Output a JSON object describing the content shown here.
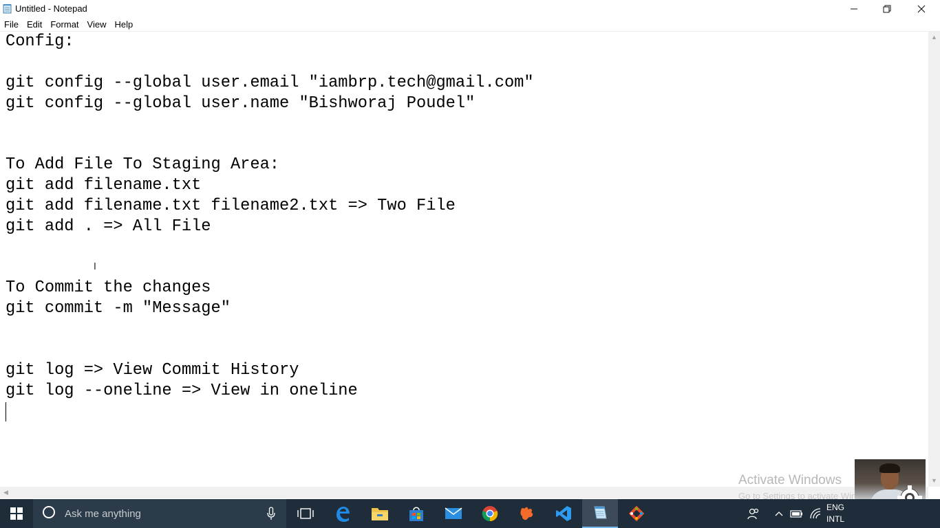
{
  "window": {
    "title": "Untitled - Notepad",
    "icon": "notepad-icon"
  },
  "menu": [
    "File",
    "Edit",
    "Format",
    "View",
    "Help"
  ],
  "editor": {
    "lines": [
      "Config:",
      "",
      "git config --global user.email \"iambrp.tech@gmail.com\"",
      "git config --global user.name \"Bishworaj Poudel\"",
      "",
      "",
      "To Add File To Staging Area:",
      "git add filename.txt",
      "git add filename.txt filename2.txt => Two File",
      "git add . => All File",
      "",
      "",
      "To Commit the changes",
      "git commit -m \"Message\"",
      "",
      "",
      "git log => View Commit History",
      "git log --oneline => View in oneline",
      ""
    ]
  },
  "watermark": {
    "title": "Activate Windows",
    "subtitle": "Go to Settings to activate Windows."
  },
  "taskbar": {
    "search_placeholder": "Ask me anything",
    "pinned": [
      "task-view-icon",
      "edge-icon",
      "file-explorer-icon",
      "store-icon",
      "mail-icon",
      "chrome-icon",
      "sublime-text-icon",
      "vscode-icon",
      "notepad-icon",
      "git-icon"
    ],
    "active_app": "notepad-icon",
    "tray": {
      "lang_primary": "ENG",
      "lang_secondary": "INTL"
    }
  },
  "colors": {
    "taskbar_bg": "#1f2d3a",
    "search_bg": "#2c3b49",
    "active_underline": "#76b9ed"
  }
}
